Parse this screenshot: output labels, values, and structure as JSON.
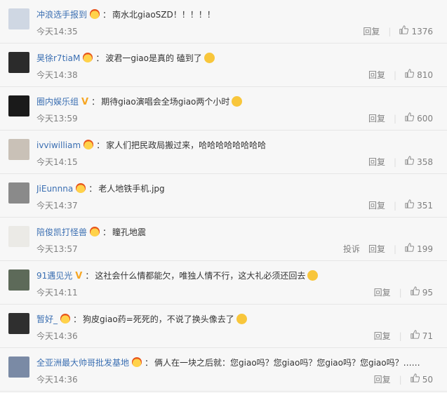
{
  "labels": {
    "reply": "回复",
    "report": "投诉"
  },
  "comments": [
    {
      "user": "冲浪选手报到",
      "badge": "crown",
      "text": "南水北giaoSZD！！！！！",
      "emoji": "",
      "time": "今天14:35",
      "report": false,
      "likes": "1376",
      "avatar_color": "#cfd7e3"
    },
    {
      "user": "昊徐r7tiaM",
      "badge": "crown",
      "text": "波君一giao是真的 磕到了",
      "emoji": "thumbs-up-icon",
      "time": "今天14:38",
      "report": false,
      "likes": "810",
      "avatar_color": "#2b2b2b"
    },
    {
      "user": "圈内娱乐组",
      "badge": "v",
      "text": "期待giao演唱会全场giao两个小时",
      "emoji": "laughing-emoji-icon",
      "time": "今天13:59",
      "report": false,
      "likes": "600",
      "avatar_color": "#1a1a1a"
    },
    {
      "user": "ivviwilliam",
      "badge": "crown",
      "text": "家人们把民政局搬过来，哈哈哈哈哈哈哈哈",
      "emoji": "",
      "time": "今天14:15",
      "report": false,
      "likes": "358",
      "avatar_color": "#c9c1b7"
    },
    {
      "user": "JiEunnna",
      "badge": "crown",
      "text": "老人地铁手机.jpg",
      "emoji": "",
      "time": "今天14:37",
      "report": false,
      "likes": "351",
      "avatar_color": "#8a8a8a"
    },
    {
      "user": "陪俊凯打怪兽",
      "badge": "crown",
      "text": "瞳孔地震",
      "emoji": "",
      "time": "今天13:57",
      "report": true,
      "likes": "199",
      "avatar_color": "#ebeae6"
    },
    {
      "user": "91遇见光",
      "badge": "v",
      "text": "这社会什么情都能欠，唯独人情不行，这大礼必须还回去",
      "emoji": "laughing-emoji-icon",
      "time": "今天14:11",
      "report": false,
      "likes": "95",
      "avatar_color": "#5d6a59"
    },
    {
      "user": "暂好_",
      "badge": "crown",
      "text": "狗皮giao药=死死的，不说了换头像去了",
      "emoji": "dog-face-emoji-icon",
      "time": "今天14:36",
      "report": false,
      "likes": "71",
      "avatar_color": "#2f2f2f"
    },
    {
      "user": "全亚洲最大帅哥批发基地",
      "badge": "crown",
      "text": "俩人在一块之后就：您giao吗？您giao吗？您giao吗？您giao吗？……",
      "emoji": "",
      "time": "今天14:36",
      "report": false,
      "likes": "50",
      "avatar_color": "#7a8aa5"
    }
  ]
}
